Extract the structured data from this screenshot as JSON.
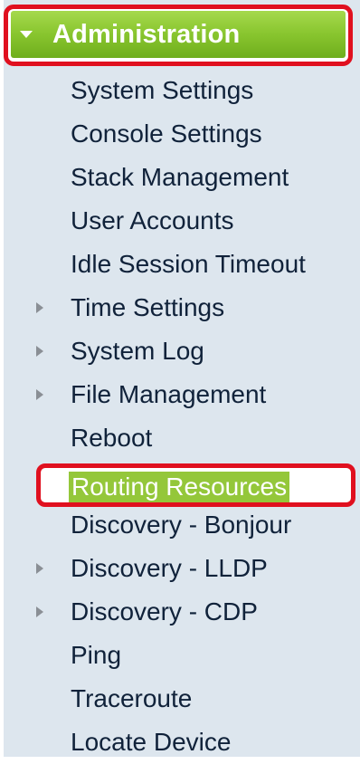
{
  "nav": {
    "admin_label": "Administration",
    "items": [
      {
        "label": "System Settings",
        "expandable": false
      },
      {
        "label": "Console Settings",
        "expandable": false
      },
      {
        "label": "Stack Management",
        "expandable": false
      },
      {
        "label": "User Accounts",
        "expandable": false
      },
      {
        "label": "Idle Session Timeout",
        "expandable": false
      },
      {
        "label": "Time Settings",
        "expandable": true
      },
      {
        "label": "System Log",
        "expandable": true
      },
      {
        "label": "File Management",
        "expandable": true
      },
      {
        "label": "Reboot",
        "expandable": false
      },
      {
        "label": "Routing Resources",
        "expandable": false,
        "selected": true
      },
      {
        "label": "Discovery - Bonjour",
        "expandable": false
      },
      {
        "label": "Discovery - LLDP",
        "expandable": true
      },
      {
        "label": "Discovery - CDP",
        "expandable": true
      },
      {
        "label": "Ping",
        "expandable": false
      },
      {
        "label": "Traceroute",
        "expandable": false
      },
      {
        "label": "Locate Device",
        "expandable": false
      }
    ]
  },
  "colors": {
    "header_green": "#88c52e",
    "highlight_red": "#e0101f",
    "selected_green": "#94c73a",
    "panel_bg": "#dde6ee",
    "text": "#10223a"
  }
}
